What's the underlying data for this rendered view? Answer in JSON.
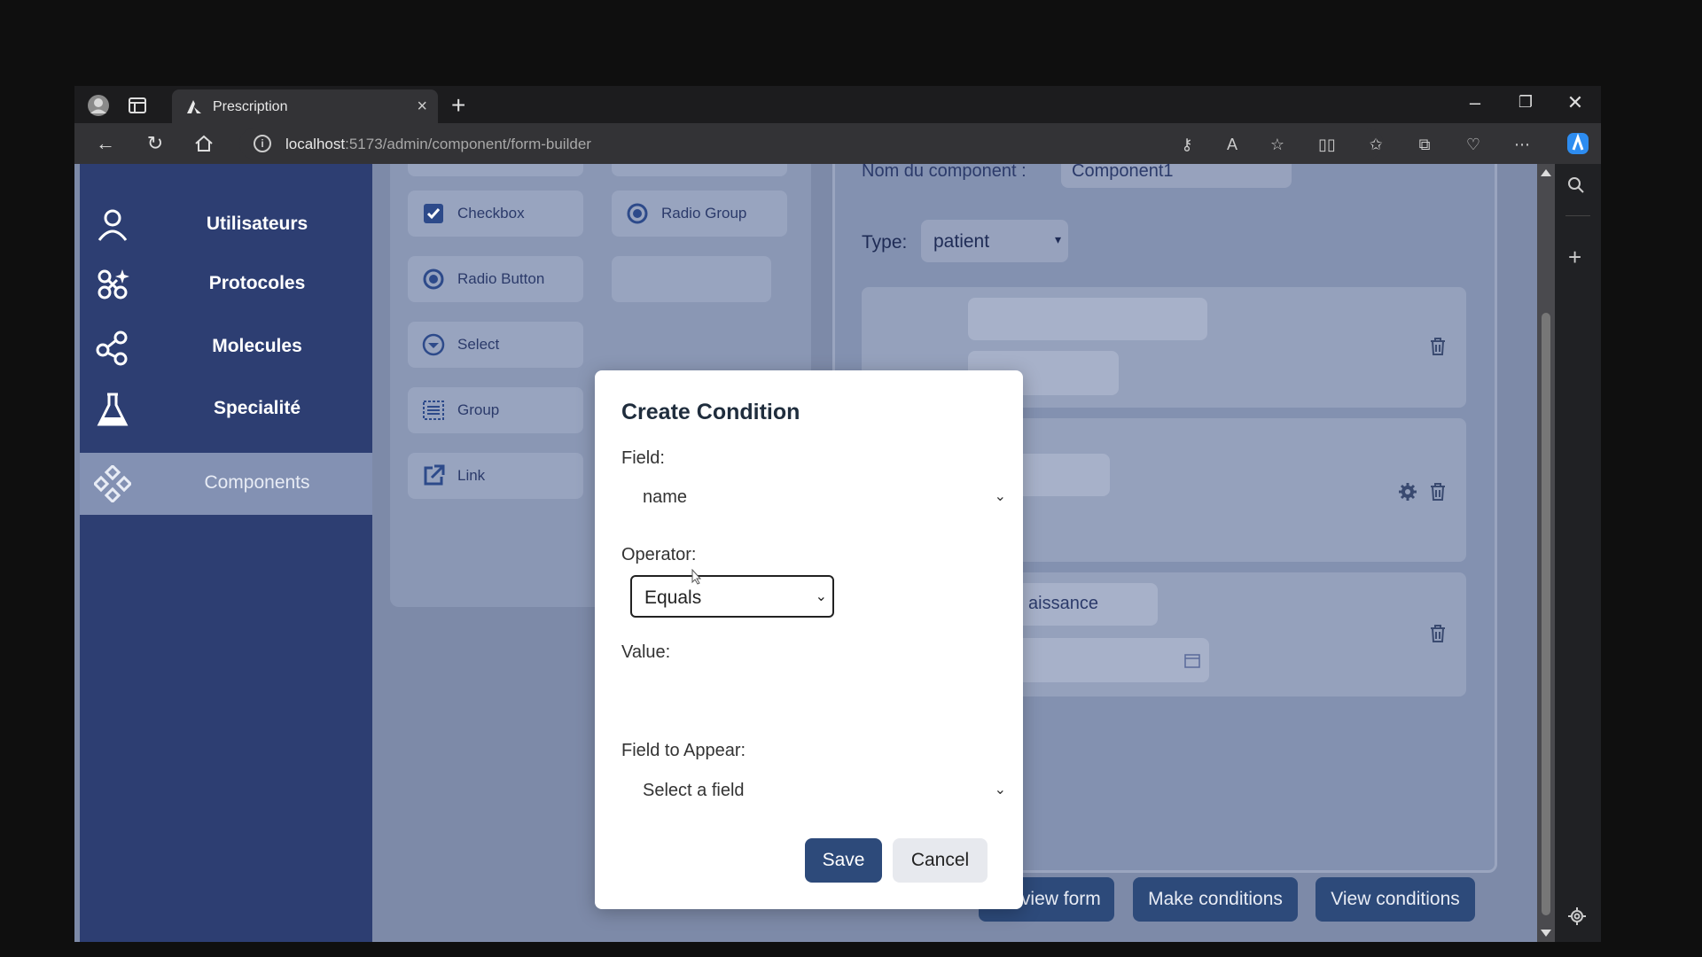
{
  "browser": {
    "tab_title": "Prescription",
    "url_host": "localhost",
    "url_rest": ":5173/admin/component/form-builder"
  },
  "sidebar": {
    "items": [
      {
        "label": "Utilisateurs",
        "icon": "user-icon"
      },
      {
        "label": "Protocoles",
        "icon": "protocol-icon"
      },
      {
        "label": "Molecules",
        "icon": "molecule-icon"
      },
      {
        "label": "Specialité",
        "icon": "flask-icon"
      },
      {
        "label": "Components",
        "icon": "components-icon",
        "active": true
      }
    ]
  },
  "palette": {
    "items": [
      {
        "label": "Checkbox",
        "icon": "checkbox-icon"
      },
      {
        "label": "Radio Group",
        "icon": "radio-group-icon"
      },
      {
        "label": "Radio Button",
        "icon": "radio-button-icon"
      },
      {
        "label": "Select",
        "icon": "select-icon"
      },
      {
        "label": "Group",
        "icon": "group-icon"
      },
      {
        "label": "Link",
        "icon": "link-icon"
      }
    ]
  },
  "builder": {
    "component_name_label": "Nom du component :",
    "component_name_value": "Component1",
    "type_label": "Type:",
    "type_value": "patient",
    "card3_field_label_fragment": "aissance"
  },
  "actions": {
    "preview": "Preview form",
    "make": "Make conditions",
    "view": "View conditions"
  },
  "modal": {
    "title": "Create Condition",
    "field_label": "Field:",
    "field_value": "name",
    "operator_label": "Operator:",
    "operator_value": "Equals",
    "value_label": "Value:",
    "value_value": "",
    "appear_label": "Field to Appear:",
    "appear_value": "Select a field",
    "save": "Save",
    "cancel": "Cancel"
  }
}
